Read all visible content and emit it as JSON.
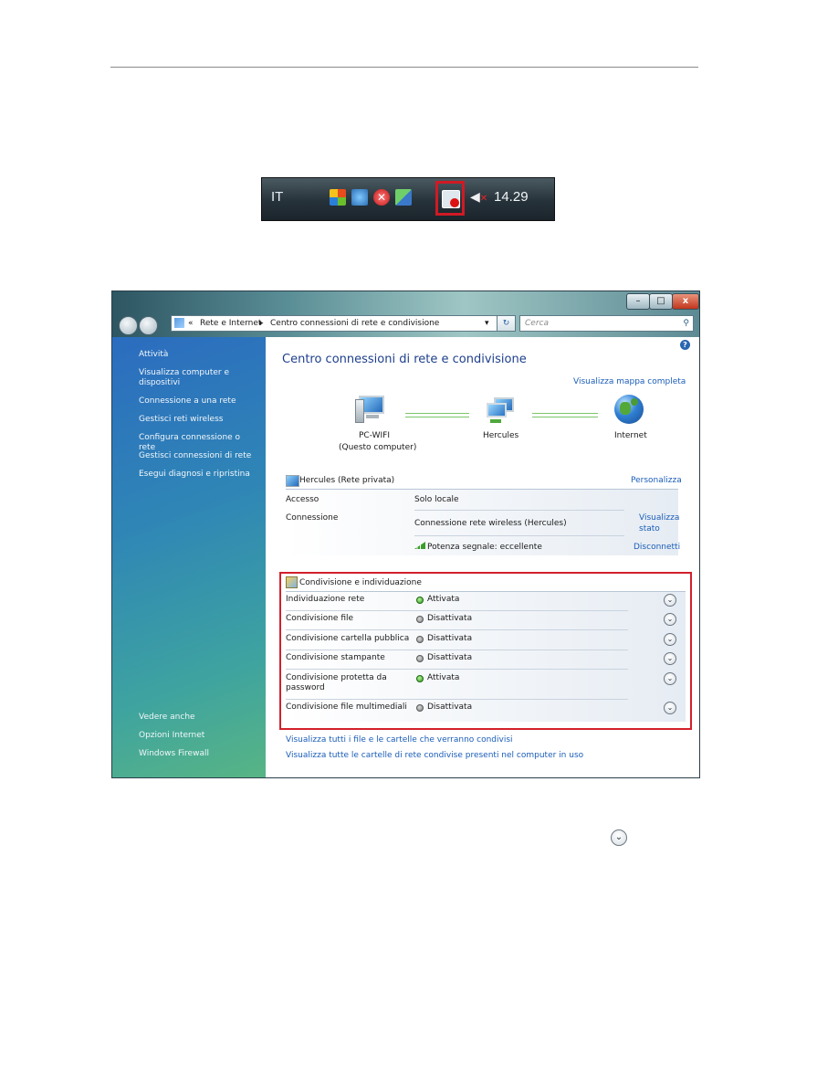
{
  "tray": {
    "language": "IT",
    "clock": "14.29",
    "icons": [
      "windows-update-icon",
      "messenger-icon",
      "error-shield-icon",
      "network-status-icon",
      "network-disconnected-icon",
      "volume-muted-icon"
    ]
  },
  "window": {
    "controls": {
      "minimize": "–",
      "maximize": "□",
      "close": "x"
    },
    "address": {
      "chevron": "«",
      "crumb1": "Rete e Internet",
      "separator": "▸",
      "crumb2": "Centro connessioni di rete e condivisione",
      "dropdown": "▾"
    },
    "refresh": "↻",
    "search_placeholder": "Cerca",
    "sidebar": {
      "tasks_title": "Attività",
      "tasks": [
        "Visualizza computer e dispositivi",
        "Connessione a una rete",
        "Gestisci reti wireless",
        "Configura connessione o rete",
        "Gestisci connessioni di rete",
        "Esegui diagnosi e ripristina"
      ],
      "see_also_title": "Vedere anche",
      "see_also": [
        "Opzioni Internet",
        "Windows Firewall"
      ]
    },
    "main": {
      "help": "?",
      "title": "Centro connessioni di rete e condivisione",
      "map_link": "Visualizza mappa completa",
      "map": {
        "pc_line1": "PC-WIFI",
        "pc_line2": "(Questo computer)",
        "router": "Hercules",
        "internet": "Internet"
      },
      "network": {
        "name": "Hercules (Rete privata)",
        "customize": "Personalizza",
        "access_label": "Accesso",
        "access_value": "Solo locale",
        "connection_label": "Connessione",
        "connection_value": "Connessione rete wireless (Hercules)",
        "view_status_1": "Visualizza",
        "view_status_2": "stato",
        "signal": "Potenza segnale: eccellente",
        "disconnect": "Disconnetti"
      },
      "sharing": {
        "title": "Condivisione e individuazione",
        "rows": [
          {
            "label": "Individuazione rete",
            "status": "Attivata",
            "on": true
          },
          {
            "label": "Condivisione file",
            "status": "Disattivata",
            "on": false
          },
          {
            "label": "Condivisione cartella pubblica",
            "status": "Disattivata",
            "on": false
          },
          {
            "label": "Condivisione stampante",
            "status": "Disattivata",
            "on": false
          },
          {
            "label": "Condivisione protetta da password",
            "status": "Attivata",
            "on": true
          },
          {
            "label": "Condivisione file multimediali",
            "status": "Disattivata",
            "on": false
          }
        ]
      },
      "bottom_links": [
        "Visualizza tutti i file e le cartelle che verranno condivisi",
        "Visualizza tutte le cartelle di rete condivise presenti nel computer in uso"
      ]
    }
  },
  "chevron_glyph": "⌄",
  "colors": {
    "highlight_red": "#d3202b",
    "link_blue": "#1a5db8",
    "title_blue": "#1e3f8c"
  }
}
